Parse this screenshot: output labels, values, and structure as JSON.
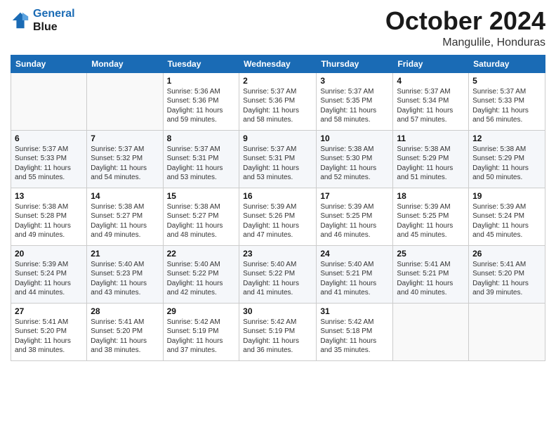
{
  "header": {
    "logo_line1": "General",
    "logo_line2": "Blue",
    "month_title": "October 2024",
    "location": "Mangulile, Honduras"
  },
  "weekdays": [
    "Sunday",
    "Monday",
    "Tuesday",
    "Wednesday",
    "Thursday",
    "Friday",
    "Saturday"
  ],
  "weeks": [
    [
      {
        "day": "",
        "sunrise": "",
        "sunset": "",
        "daylight": ""
      },
      {
        "day": "",
        "sunrise": "",
        "sunset": "",
        "daylight": ""
      },
      {
        "day": "1",
        "sunrise": "Sunrise: 5:36 AM",
        "sunset": "Sunset: 5:36 PM",
        "daylight": "Daylight: 11 hours and 59 minutes."
      },
      {
        "day": "2",
        "sunrise": "Sunrise: 5:37 AM",
        "sunset": "Sunset: 5:36 PM",
        "daylight": "Daylight: 11 hours and 58 minutes."
      },
      {
        "day": "3",
        "sunrise": "Sunrise: 5:37 AM",
        "sunset": "Sunset: 5:35 PM",
        "daylight": "Daylight: 11 hours and 58 minutes."
      },
      {
        "day": "4",
        "sunrise": "Sunrise: 5:37 AM",
        "sunset": "Sunset: 5:34 PM",
        "daylight": "Daylight: 11 hours and 57 minutes."
      },
      {
        "day": "5",
        "sunrise": "Sunrise: 5:37 AM",
        "sunset": "Sunset: 5:33 PM",
        "daylight": "Daylight: 11 hours and 56 minutes."
      }
    ],
    [
      {
        "day": "6",
        "sunrise": "Sunrise: 5:37 AM",
        "sunset": "Sunset: 5:33 PM",
        "daylight": "Daylight: 11 hours and 55 minutes."
      },
      {
        "day": "7",
        "sunrise": "Sunrise: 5:37 AM",
        "sunset": "Sunset: 5:32 PM",
        "daylight": "Daylight: 11 hours and 54 minutes."
      },
      {
        "day": "8",
        "sunrise": "Sunrise: 5:37 AM",
        "sunset": "Sunset: 5:31 PM",
        "daylight": "Daylight: 11 hours and 53 minutes."
      },
      {
        "day": "9",
        "sunrise": "Sunrise: 5:37 AM",
        "sunset": "Sunset: 5:31 PM",
        "daylight": "Daylight: 11 hours and 53 minutes."
      },
      {
        "day": "10",
        "sunrise": "Sunrise: 5:38 AM",
        "sunset": "Sunset: 5:30 PM",
        "daylight": "Daylight: 11 hours and 52 minutes."
      },
      {
        "day": "11",
        "sunrise": "Sunrise: 5:38 AM",
        "sunset": "Sunset: 5:29 PM",
        "daylight": "Daylight: 11 hours and 51 minutes."
      },
      {
        "day": "12",
        "sunrise": "Sunrise: 5:38 AM",
        "sunset": "Sunset: 5:29 PM",
        "daylight": "Daylight: 11 hours and 50 minutes."
      }
    ],
    [
      {
        "day": "13",
        "sunrise": "Sunrise: 5:38 AM",
        "sunset": "Sunset: 5:28 PM",
        "daylight": "Daylight: 11 hours and 49 minutes."
      },
      {
        "day": "14",
        "sunrise": "Sunrise: 5:38 AM",
        "sunset": "Sunset: 5:27 PM",
        "daylight": "Daylight: 11 hours and 49 minutes."
      },
      {
        "day": "15",
        "sunrise": "Sunrise: 5:38 AM",
        "sunset": "Sunset: 5:27 PM",
        "daylight": "Daylight: 11 hours and 48 minutes."
      },
      {
        "day": "16",
        "sunrise": "Sunrise: 5:39 AM",
        "sunset": "Sunset: 5:26 PM",
        "daylight": "Daylight: 11 hours and 47 minutes."
      },
      {
        "day": "17",
        "sunrise": "Sunrise: 5:39 AM",
        "sunset": "Sunset: 5:25 PM",
        "daylight": "Daylight: 11 hours and 46 minutes."
      },
      {
        "day": "18",
        "sunrise": "Sunrise: 5:39 AM",
        "sunset": "Sunset: 5:25 PM",
        "daylight": "Daylight: 11 hours and 45 minutes."
      },
      {
        "day": "19",
        "sunrise": "Sunrise: 5:39 AM",
        "sunset": "Sunset: 5:24 PM",
        "daylight": "Daylight: 11 hours and 45 minutes."
      }
    ],
    [
      {
        "day": "20",
        "sunrise": "Sunrise: 5:39 AM",
        "sunset": "Sunset: 5:24 PM",
        "daylight": "Daylight: 11 hours and 44 minutes."
      },
      {
        "day": "21",
        "sunrise": "Sunrise: 5:40 AM",
        "sunset": "Sunset: 5:23 PM",
        "daylight": "Daylight: 11 hours and 43 minutes."
      },
      {
        "day": "22",
        "sunrise": "Sunrise: 5:40 AM",
        "sunset": "Sunset: 5:22 PM",
        "daylight": "Daylight: 11 hours and 42 minutes."
      },
      {
        "day": "23",
        "sunrise": "Sunrise: 5:40 AM",
        "sunset": "Sunset: 5:22 PM",
        "daylight": "Daylight: 11 hours and 41 minutes."
      },
      {
        "day": "24",
        "sunrise": "Sunrise: 5:40 AM",
        "sunset": "Sunset: 5:21 PM",
        "daylight": "Daylight: 11 hours and 41 minutes."
      },
      {
        "day": "25",
        "sunrise": "Sunrise: 5:41 AM",
        "sunset": "Sunset: 5:21 PM",
        "daylight": "Daylight: 11 hours and 40 minutes."
      },
      {
        "day": "26",
        "sunrise": "Sunrise: 5:41 AM",
        "sunset": "Sunset: 5:20 PM",
        "daylight": "Daylight: 11 hours and 39 minutes."
      }
    ],
    [
      {
        "day": "27",
        "sunrise": "Sunrise: 5:41 AM",
        "sunset": "Sunset: 5:20 PM",
        "daylight": "Daylight: 11 hours and 38 minutes."
      },
      {
        "day": "28",
        "sunrise": "Sunrise: 5:41 AM",
        "sunset": "Sunset: 5:20 PM",
        "daylight": "Daylight: 11 hours and 38 minutes."
      },
      {
        "day": "29",
        "sunrise": "Sunrise: 5:42 AM",
        "sunset": "Sunset: 5:19 PM",
        "daylight": "Daylight: 11 hours and 37 minutes."
      },
      {
        "day": "30",
        "sunrise": "Sunrise: 5:42 AM",
        "sunset": "Sunset: 5:19 PM",
        "daylight": "Daylight: 11 hours and 36 minutes."
      },
      {
        "day": "31",
        "sunrise": "Sunrise: 5:42 AM",
        "sunset": "Sunset: 5:18 PM",
        "daylight": "Daylight: 11 hours and 35 minutes."
      },
      {
        "day": "",
        "sunrise": "",
        "sunset": "",
        "daylight": ""
      },
      {
        "day": "",
        "sunrise": "",
        "sunset": "",
        "daylight": ""
      }
    ]
  ]
}
